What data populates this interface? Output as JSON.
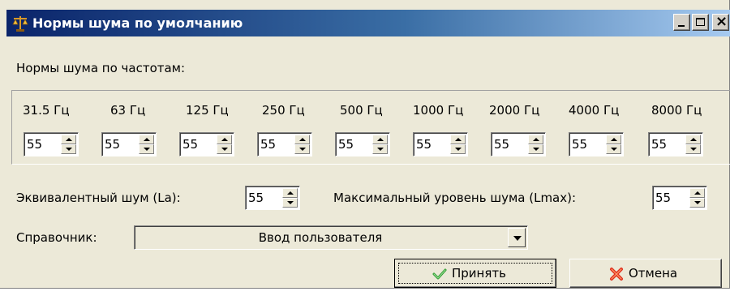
{
  "window": {
    "title": "Нормы шума по умолчанию",
    "icon": "scales-icon",
    "controls": {
      "minimize": "minimize-icon",
      "maximize": "maximize-icon",
      "close": "close-icon"
    }
  },
  "frequency_section": {
    "label": "Нормы шума по частотам:",
    "bands": [
      {
        "label": "31.5 Гц",
        "value": "55"
      },
      {
        "label": "63 Гц",
        "value": "55"
      },
      {
        "label": "125 Гц",
        "value": "55"
      },
      {
        "label": "250 Гц",
        "value": "55"
      },
      {
        "label": "500 Гц",
        "value": "55"
      },
      {
        "label": "1000 Гц",
        "value": "55"
      },
      {
        "label": "2000 Гц",
        "value": "55"
      },
      {
        "label": "4000 Гц",
        "value": "55"
      },
      {
        "label": "8000 Гц",
        "value": "55"
      }
    ]
  },
  "equivalent": {
    "label": "Эквивалентный шум (La):",
    "value": "55"
  },
  "maximum": {
    "label": "Максимальный уровень шума (Lmax):",
    "value": "55"
  },
  "reference": {
    "label": "Справочник:",
    "selected": "Ввод пользователя"
  },
  "buttons": {
    "accept": {
      "label": "Принять",
      "icon": "checkmark-icon"
    },
    "cancel": {
      "label": "Отмена",
      "icon": "cross-icon"
    }
  }
}
